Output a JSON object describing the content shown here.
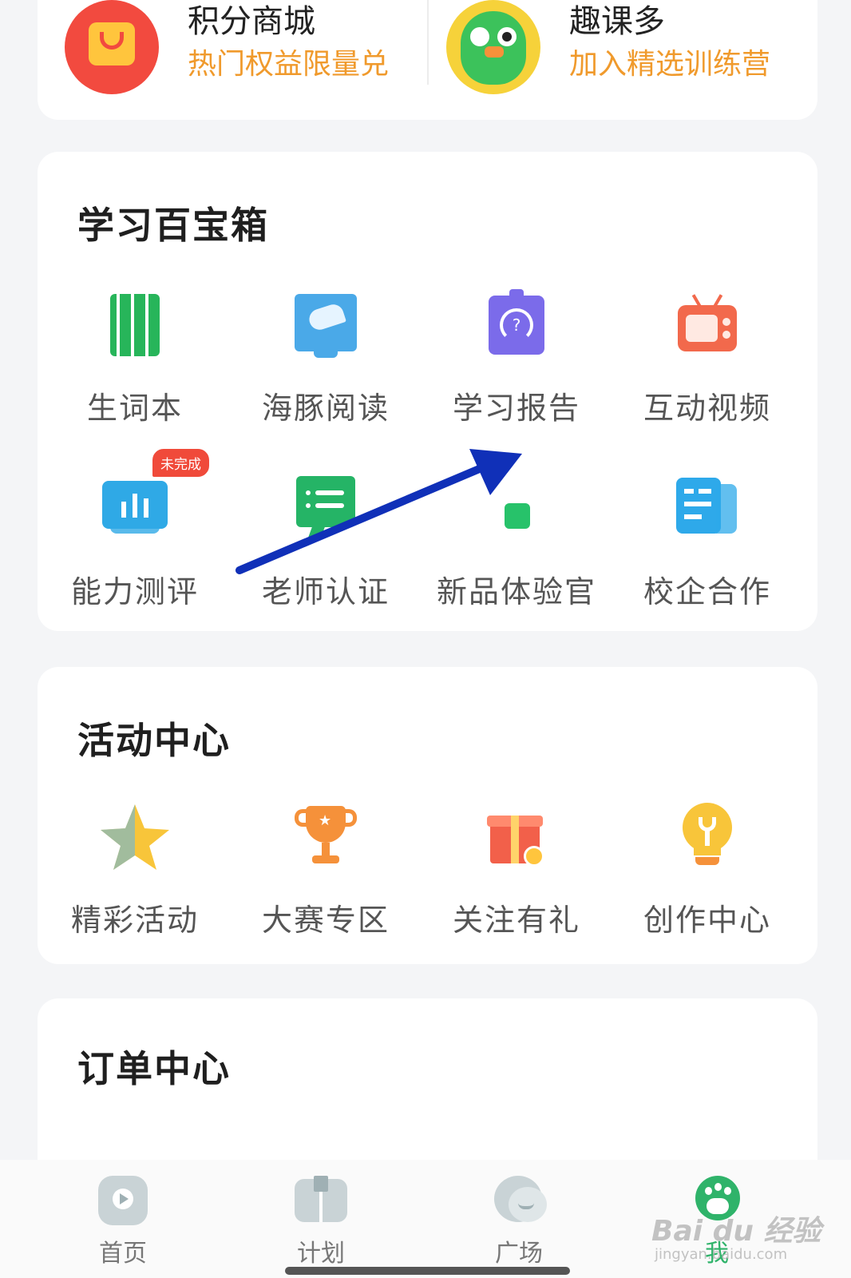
{
  "promo": {
    "points_mall": {
      "title": "积分商城",
      "subtitle": "热门权益限量兑"
    },
    "fun_course": {
      "title": "趣课多",
      "subtitle": "加入精选训练营"
    }
  },
  "toolbox": {
    "title": "学习百宝箱",
    "items": [
      {
        "label": "生词本",
        "icon": "notebook-icon"
      },
      {
        "label": "海豚阅读",
        "icon": "dolphin-book-icon"
      },
      {
        "label": "学习报告",
        "icon": "report-icon"
      },
      {
        "label": "互动视频",
        "icon": "tv-icon"
      },
      {
        "label": "能力测评",
        "icon": "chart-board-icon",
        "badge": "未完成"
      },
      {
        "label": "老师认证",
        "icon": "teacher-board-icon"
      },
      {
        "label": "新品体验官",
        "icon": "new-product-icon"
      },
      {
        "label": "校企合作",
        "icon": "cooperation-icon"
      }
    ]
  },
  "activity": {
    "title": "活动中心",
    "items": [
      {
        "label": "精彩活动",
        "icon": "star-icon"
      },
      {
        "label": "大赛专区",
        "icon": "trophy-icon"
      },
      {
        "label": "关注有礼",
        "icon": "gift-icon"
      },
      {
        "label": "创作中心",
        "icon": "lightbulb-icon"
      }
    ]
  },
  "orders": {
    "title": "订单中心"
  },
  "nav": {
    "items": [
      {
        "label": "首页",
        "icon": "play-home-icon"
      },
      {
        "label": "计划",
        "icon": "book-plan-icon"
      },
      {
        "label": "广场",
        "icon": "chat-square-icon"
      },
      {
        "label": "我",
        "icon": "paw-me-icon",
        "active": true
      }
    ]
  },
  "watermark": {
    "brand": "Bai du 经验",
    "url": "jingyan.baidu.com"
  },
  "colors": {
    "accent_green": "#2fb36a",
    "promo_orange": "#f09a2c",
    "badge_red": "#f04a3a",
    "annotation_blue": "#1030b8"
  }
}
